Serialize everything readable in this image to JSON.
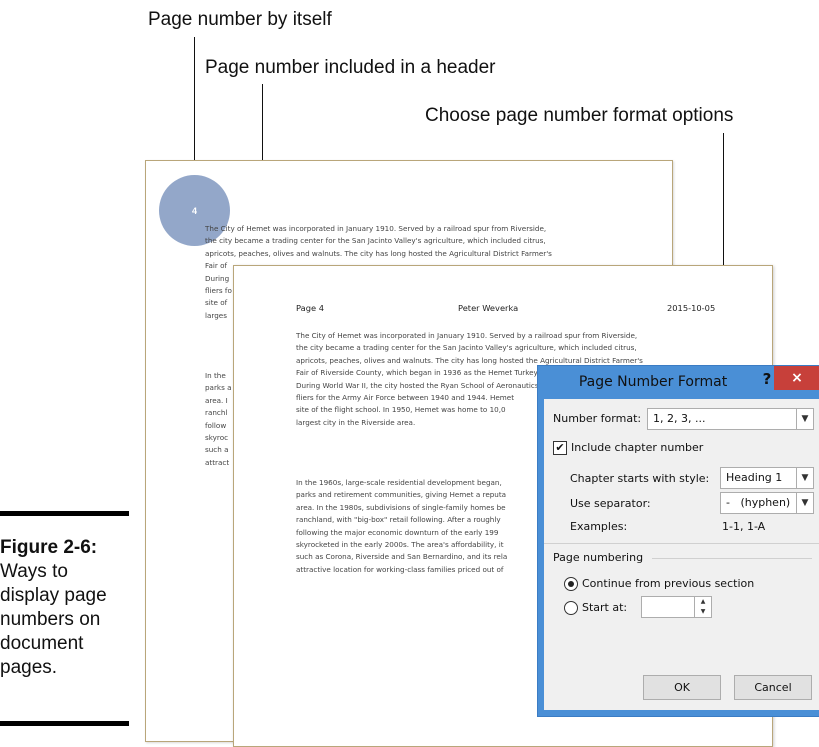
{
  "callouts": {
    "by_itself": "Page number by itself",
    "in_header": "Page number included in a header",
    "format_options": "Choose page number format options"
  },
  "doc_back": {
    "page_number": "4",
    "paragraph1": [
      "The City of Hemet was incorporated in January 1910. Served by a railroad spur from Riverside,",
      "the city became a trading center for the San Jacinto Valley's agriculture, which included citrus,",
      "apricots, peaches, olives and walnuts. The city has long hosted the Agricultural District Farmer's",
      "Fair of",
      "During",
      "fliers fo",
      "site of",
      "larges"
    ],
    "paragraph2": [
      "In the",
      "parks a",
      "area. I",
      "ranchl",
      "follow",
      "skyroc",
      "such a",
      "attract"
    ]
  },
  "doc_front": {
    "header": {
      "left": "Page 4",
      "center": "Peter Weverka",
      "right": "2015-10-05"
    },
    "paragraph1": [
      "The City of Hemet was incorporated in January 1910. Served by a railroad spur from Riverside,",
      "the city became a trading center for the San Jacinto Valley's agriculture, which included citrus,",
      "apricots, peaches, olives and walnuts. The city has long hosted the Agricultural District Farmer's",
      "Fair of Riverside County, which began in 1936 as the Hemet Turkey Show, now located in Perris.",
      "During World War II, the city hosted the Ryan School of Aeronautics, which trained about 6,000",
      "fliers for the Army Air Force between 1940 and 1944. Hemet",
      "site of the flight school. In 1950, Hemet was home to 10,0",
      "largest city in the Riverside area."
    ],
    "paragraph2": [
      "In the 1960s, large-scale residential development began,",
      "parks and retirement communities, giving Hemet a reputa",
      "area. In the 1980s, subdivisions of single-family homes be",
      "ranchland, with \"big-box\" retail following. After a roughly",
      "following the major economic downturn of the early 199",
      "skyrocketed in the early 2000s. The area's affordability, it",
      "such as Corona, Riverside and San Bernardino, and its rela",
      "attractive location for working-class families priced out of"
    ]
  },
  "figure": {
    "label": "Figure 2-6:",
    "caption": [
      "Ways to",
      "display page",
      "numbers on",
      "document",
      "pages."
    ]
  },
  "dialog": {
    "title": "Page Number Format",
    "help": "?",
    "close": "×",
    "number_format_label": "Number format:",
    "number_format_value": "1, 2, 3, ...",
    "include_chapter_label": "Include chapter number",
    "include_chapter_checked": true,
    "chapter_style_label": "Chapter starts with style:",
    "chapter_style_value": "Heading 1",
    "separator_label": "Use separator:",
    "separator_value": "-   (hyphen)",
    "examples_label": "Examples:",
    "examples_value": "1-1, 1-A",
    "page_numbering_label": "Page numbering",
    "continue_label": "Continue from previous section",
    "start_at_label": "Start at:",
    "start_at_value": "",
    "selected_option": "continue",
    "ok_label": "OK",
    "cancel_label": "Cancel"
  },
  "colors": {
    "circle": "#93a7c9",
    "dialog_frame": "#4a8fd6",
    "close_button": "#c7403a",
    "page_border": "#b9a67a"
  }
}
